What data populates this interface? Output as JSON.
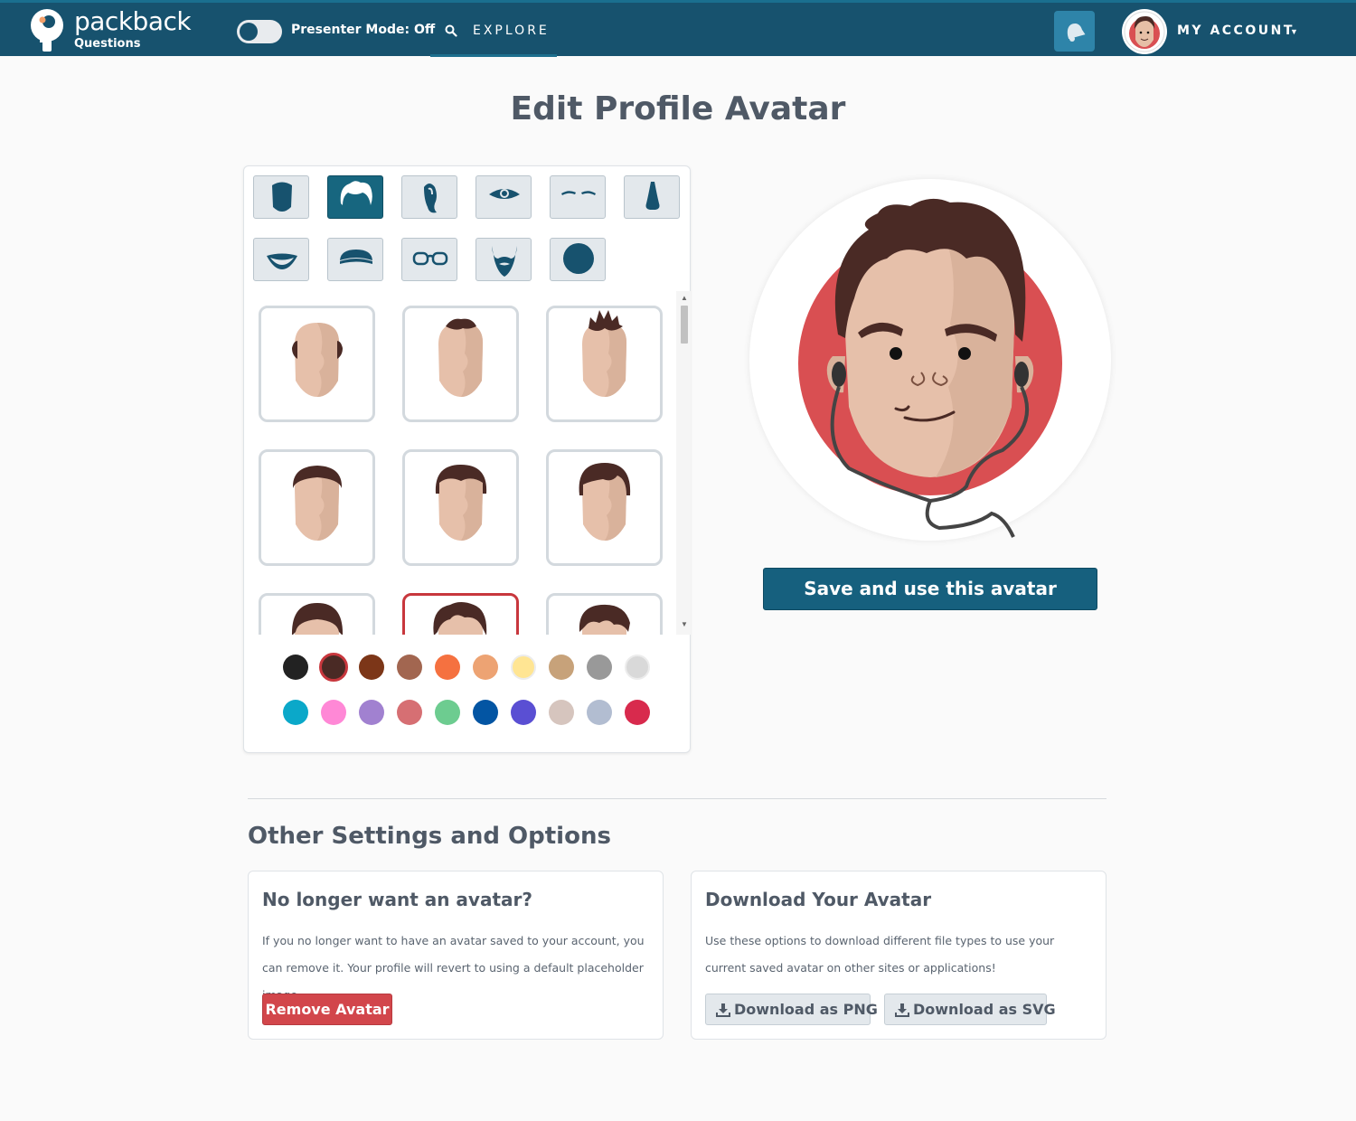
{
  "nav": {
    "brand": "packback",
    "brand_sub": "Questions",
    "presenter_mode": "Presenter Mode: Off",
    "explore": "EXPLORE",
    "account": "MY ACCOUNT"
  },
  "page_title": "Edit Profile Avatar",
  "feature_tabs": [
    {
      "icon": "face-shape-icon",
      "active": false
    },
    {
      "icon": "hair-icon",
      "active": true
    },
    {
      "icon": "ear-icon",
      "active": false
    },
    {
      "icon": "eye-icon",
      "active": false
    },
    {
      "icon": "eyebrows-icon",
      "active": false
    },
    {
      "icon": "nose-icon",
      "active": false
    },
    {
      "icon": "mouth-icon",
      "active": false
    },
    {
      "icon": "hat-icon",
      "active": false
    },
    {
      "icon": "glasses-icon",
      "active": false
    },
    {
      "icon": "beard-icon",
      "active": false
    },
    {
      "icon": "background-circle-icon",
      "active": false
    }
  ],
  "hair_options": [
    "bald-sides",
    "top-tuft",
    "spiky",
    "short-flat",
    "short-sides",
    "side-swept",
    "crew-cut",
    "messy-selected",
    "quiff"
  ],
  "selected_hair_option": 7,
  "colors": {
    "row1": [
      "#222222",
      "#4a2a25",
      "#7c3618",
      "#a26650",
      "#f57140",
      "#eda373",
      "#ffe593",
      "#c7a27a",
      "#999999",
      "#d9d9d9"
    ],
    "row2": [
      "#0ba8c9",
      "#ff88d6",
      "#a181d0",
      "#d66f73",
      "#6dcc90",
      "#0355a3",
      "#5a4fd3",
      "#d6c5be",
      "#b2bdd1",
      "#d82a4d"
    ],
    "selected": "#4a2a25",
    "accent": "#17526e",
    "danger": "#d2464b"
  },
  "save_button": "Save and use this avatar",
  "other_settings_title": "Other Settings and Options",
  "remove_card": {
    "title": "No longer want an avatar?",
    "body": "If you no longer want to have an avatar saved to your account, you can remove it. Your profile will revert to using a default placeholder image.",
    "button": "Remove Avatar"
  },
  "download_card": {
    "title": "Download Your Avatar",
    "body": "Use these options to download different file types to use your current saved avatar on other sites or applications!",
    "png_button": "Download as PNG",
    "svg_button": "Download as SVG"
  }
}
